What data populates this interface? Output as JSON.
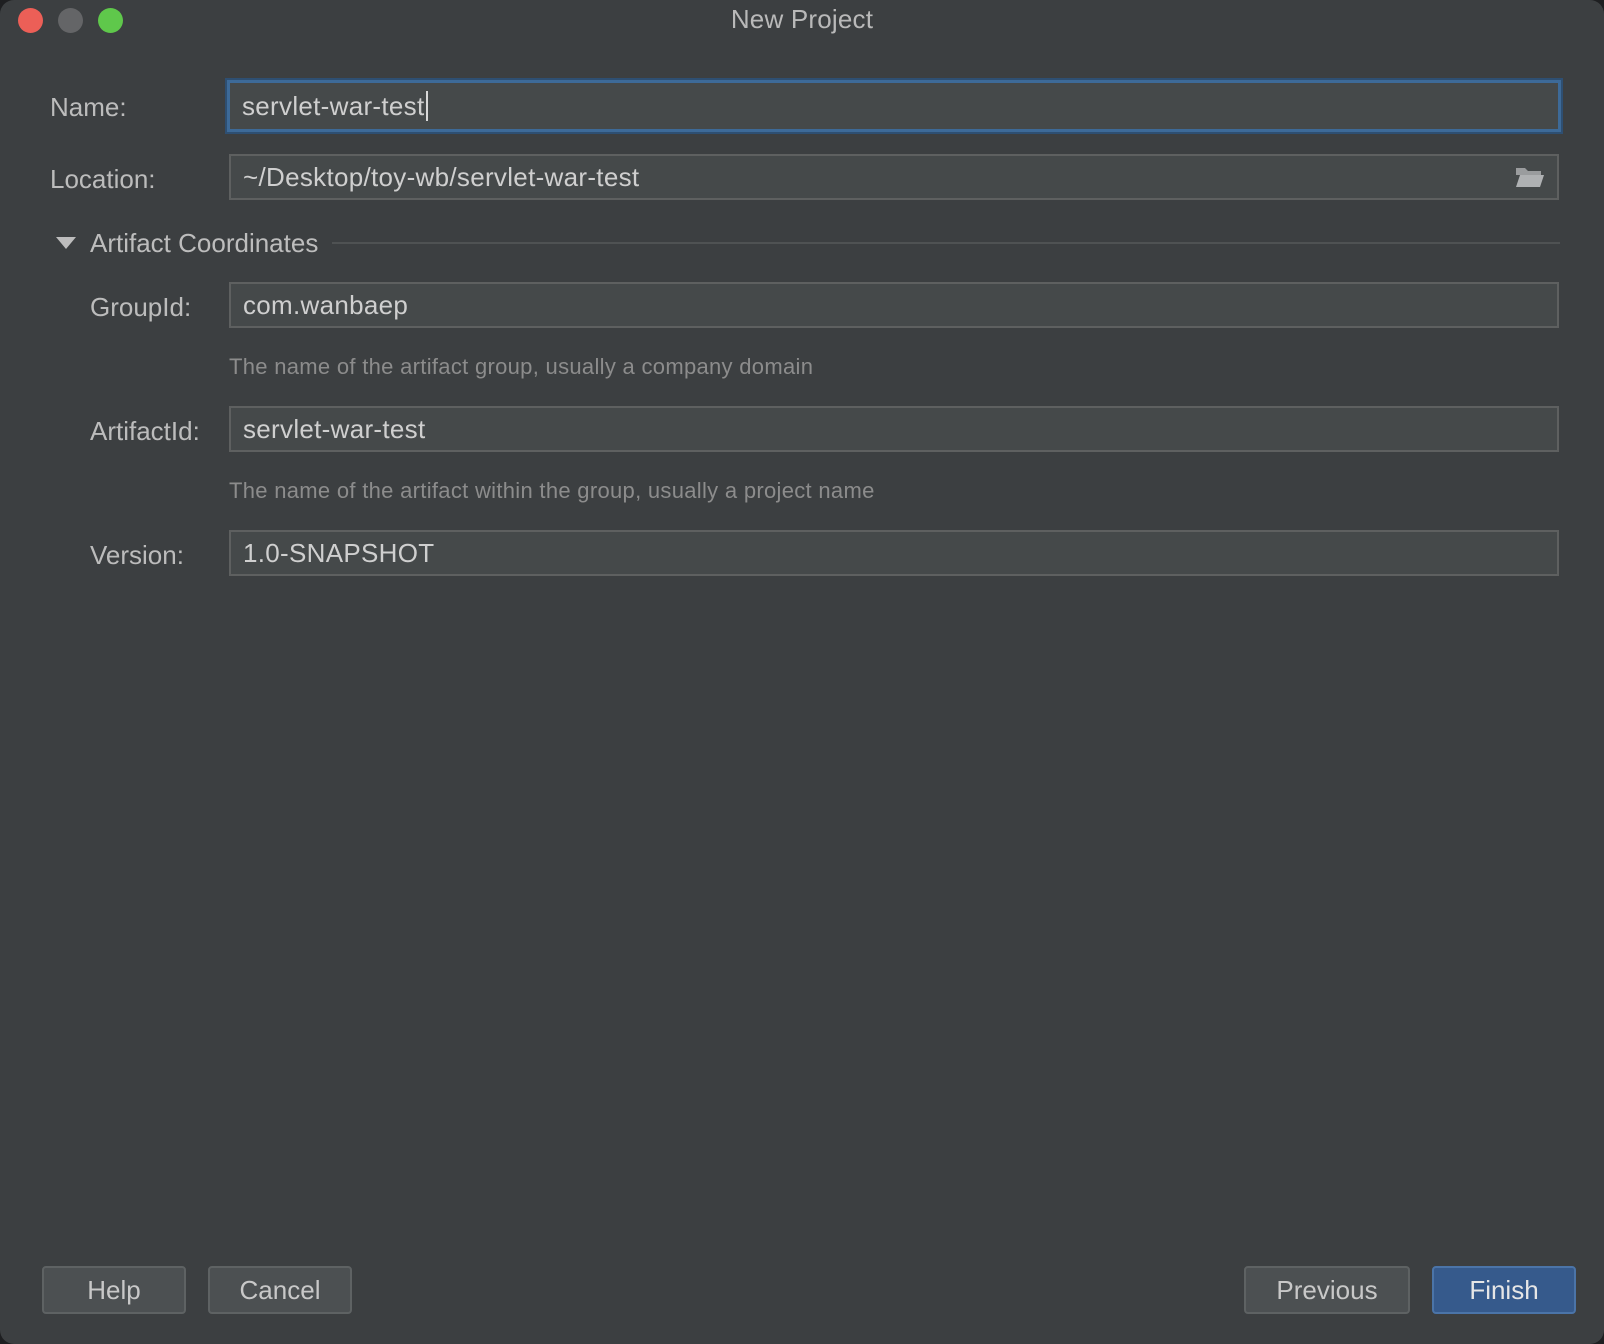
{
  "window": {
    "title": "New Project"
  },
  "form": {
    "name": {
      "label": "Name:",
      "value": "servlet-war-test"
    },
    "location": {
      "label": "Location:",
      "value": "~/Desktop/toy-wb/servlet-war-test"
    },
    "section_title": "Artifact Coordinates",
    "group_id": {
      "label": "GroupId:",
      "value": "com.wanbaep",
      "hint": "The name of the artifact group, usually a company domain"
    },
    "artifact_id": {
      "label": "ArtifactId:",
      "value": "servlet-war-test",
      "hint": "The name of the artifact within the group, usually a project name"
    },
    "version": {
      "label": "Version:",
      "value": "1.0-SNAPSHOT"
    }
  },
  "buttons": {
    "help": "Help",
    "cancel": "Cancel",
    "previous": "Previous",
    "finish": "Finish"
  },
  "colors": {
    "background": "#3c3f41",
    "field": "#45494a",
    "focus_border": "#3d6a98",
    "primary_button": "#365a8c"
  },
  "icons": {
    "browse": "folder-open-icon",
    "collapse": "triangle-down-icon"
  }
}
